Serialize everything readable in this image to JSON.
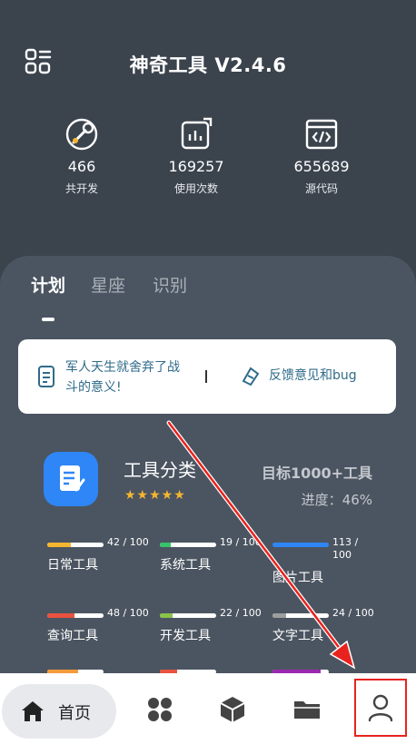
{
  "header": {
    "title": "神奇工具 V2.4.6",
    "menu_icon": "grid-menu-icon"
  },
  "stats": [
    {
      "value": "466",
      "label": "共开发",
      "icon": "wrench-icon"
    },
    {
      "value": "169257",
      "label": "使用次数",
      "icon": "chart-icon"
    },
    {
      "value": "655689",
      "label": "源代码",
      "icon": "code-icon"
    }
  ],
  "tabs": [
    {
      "label": "计划",
      "active": true
    },
    {
      "label": "星座",
      "active": false
    },
    {
      "label": "识别",
      "active": false
    }
  ],
  "notice": {
    "text": "军人天生就舍弃了战斗的意义!",
    "separator": "|",
    "feedback": "反馈意见和bug"
  },
  "category": {
    "title": "工具分类",
    "stars": "★★★★★",
    "goal": "目标1000+工具",
    "progress": "进度：46%"
  },
  "tools": [
    {
      "name": "日常工具",
      "count": "42 / 100",
      "progress": 0.42,
      "color": "#f5b630"
    },
    {
      "name": "系统工具",
      "count": "19 / 100",
      "progress": 0.19,
      "color": "#35c46a"
    },
    {
      "name": "图片工具",
      "count": "113 / 100",
      "progress": 1.0,
      "color": "#2f86f6"
    },
    {
      "name": "查询工具",
      "count": "48 / 100",
      "progress": 0.48,
      "color": "#e8523f"
    },
    {
      "name": "开发工具",
      "count": "22 / 100",
      "progress": 0.22,
      "color": "#8bc34a"
    },
    {
      "name": "文字工具",
      "count": "24 / 100",
      "progress": 0.24,
      "color": "#9e9e9e"
    }
  ],
  "nav": {
    "home_label": "首页",
    "items": [
      "home-icon",
      "apps-icon",
      "cube-icon",
      "folder-icon",
      "user-icon"
    ]
  },
  "colors": {
    "accent": "#2f86f6",
    "highlight": "#e8231f",
    "background": "#3b434d"
  }
}
